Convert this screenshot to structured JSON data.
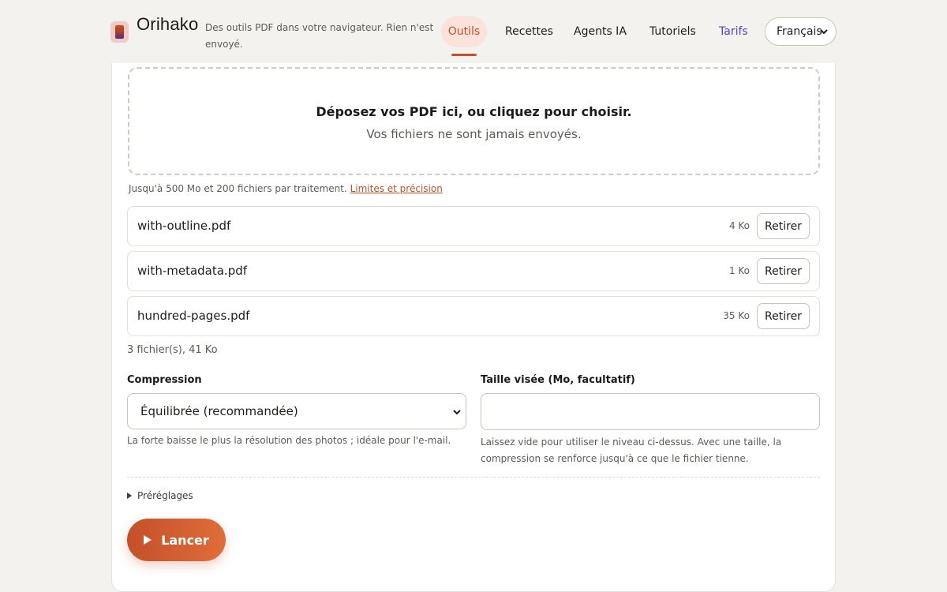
{
  "header": {
    "brand_name": "Orihako",
    "tagline": "Des outils PDF dans votre navigateur. Rien n'est envoyé.",
    "nav": [
      {
        "label": "Outils",
        "active": true
      },
      {
        "label": "Recettes"
      },
      {
        "label": "Agents IA"
      },
      {
        "label": "Tutoriels"
      },
      {
        "label": "Tarifs"
      }
    ],
    "language": "Français"
  },
  "dropzone": {
    "title": "Déposez vos PDF ici, ou cliquez pour choisir.",
    "subtitle": "Vos fichiers ne sont jamais envoyés."
  },
  "limits": {
    "text": "Jusqu'à 500 Mo et 200 fichiers par traitement.",
    "link": "Limites et précision"
  },
  "files": [
    {
      "name": "with-outline.pdf",
      "size": "4 Ko",
      "remove_label": "Retirer"
    },
    {
      "name": "with-metadata.pdf",
      "size": "1 Ko",
      "remove_label": "Retirer"
    },
    {
      "name": "hundred-pages.pdf",
      "size": "35 Ko",
      "remove_label": "Retirer"
    }
  ],
  "summary": "3 fichier(s), 41 Ko",
  "compression": {
    "label": "Compression",
    "selected": "Équilibrée (recommandée)",
    "help": "La forte baisse le plus la résolution des photos ; idéale pour l'e-mail."
  },
  "target_size": {
    "label": "Taille visée (Mo, facultatif)",
    "value": "",
    "help": "Laissez vide pour utiliser le niveau ci-dessus. Avec une taille, la compression se renforce jusqu'à ce que le fichier tienne."
  },
  "presets_label": "Préréglages",
  "run_label": "Lancer",
  "colors": {
    "accent": "#c2522a",
    "pricing": "#5b3fc4"
  },
  "icons": {
    "logo": "orihako-logo-icon",
    "chevron": "chevron-down-icon",
    "disclosure": "disclosure-triangle-icon",
    "play": "play-icon"
  }
}
